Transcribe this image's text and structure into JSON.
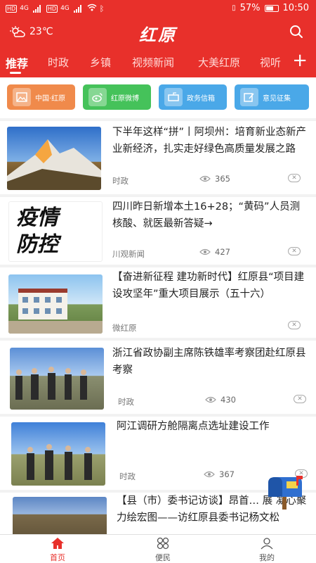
{
  "status": {
    "carrier1": "HD",
    "carrier2": "HD",
    "net1": "4G",
    "net2": "4G",
    "battery": "57%",
    "time": "10:50"
  },
  "header": {
    "weather": "23℃",
    "logo": "红原"
  },
  "tabs": [
    "推荐",
    "时政",
    "乡镇",
    "视频新闻",
    "大美红原",
    "视听"
  ],
  "quick_links": [
    {
      "label": "中国·红原",
      "color": "#f08a4b"
    },
    {
      "label": "红原微博",
      "color": "#45c25a"
    },
    {
      "label": "政务信箱",
      "color": "#4aa8e8"
    },
    {
      "label": "意见征集",
      "color": "#4aa8e8"
    }
  ],
  "news": [
    {
      "title": "下半年这样“拼”丨阿坝州：培育新业态新产业新经济，扎实走好绿色高质量发展之路",
      "source": "时政",
      "views": "365"
    },
    {
      "title": "四川昨日新增本土16+28；“黄码”人员测核酸、就医最新答疑→",
      "source": "川观新闻",
      "views": "427",
      "thumb_text": "疫情防控"
    },
    {
      "title": "【奋进新征程 建功新时代】红原县“项目建设攻坚年”重大项目展示（五十六）",
      "source": "微红原",
      "views": ""
    },
    {
      "title": "浙江省政协副主席陈铁雄率考察团赴红原县考察",
      "source": "时政",
      "views": "430"
    },
    {
      "title": "阿江调研方舱隔离点选址建设工作",
      "source": "时政",
      "views": "367"
    },
    {
      "title": "【县（市）委书记访谈】昂首… 展 凝心聚力绘宏图——访红原县委书记杨文松",
      "source": "",
      "views": ""
    }
  ],
  "bottom_nav": [
    "首页",
    "便民",
    "我的"
  ]
}
